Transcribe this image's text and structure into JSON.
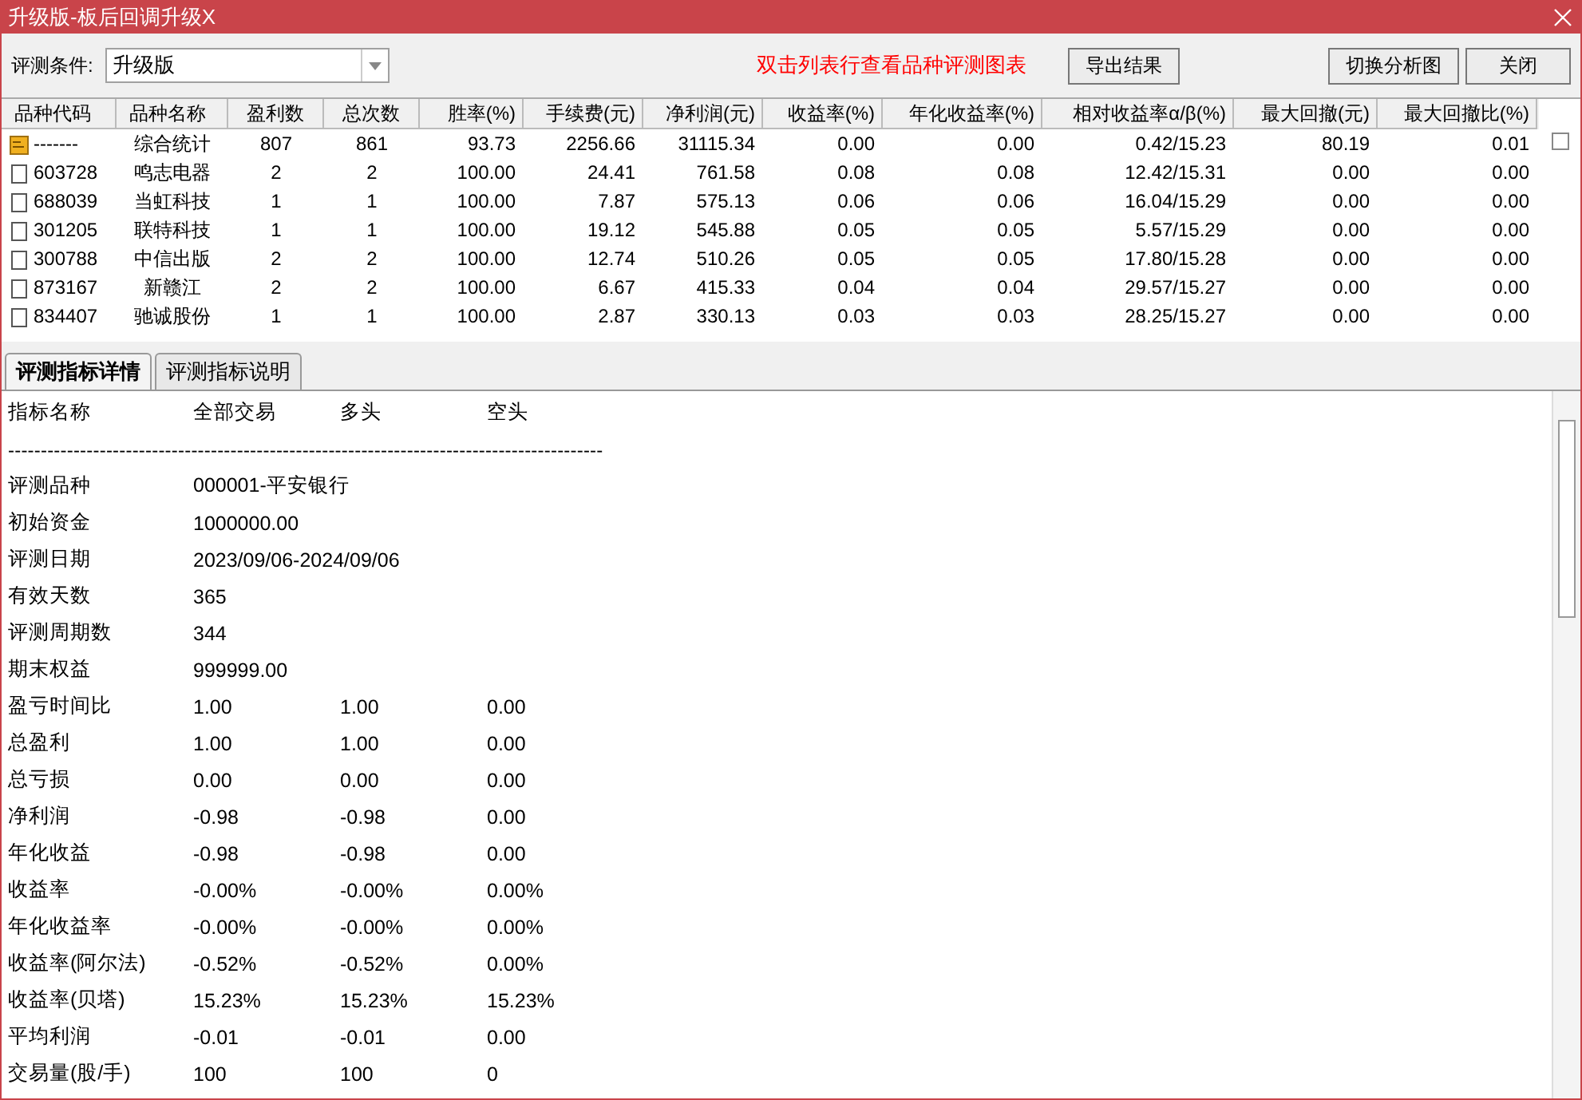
{
  "window": {
    "title": "升级版-板后回调升级X"
  },
  "toolbar": {
    "condition_label": "评测条件:",
    "condition_value": "升级版",
    "hint": "双击列表行查看品种评测图表",
    "buttons": [
      {
        "label": "导出结果",
        "kind": "left"
      },
      {
        "label": "切换分析图",
        "kind": "right"
      },
      {
        "label": "关闭",
        "kind": "right"
      }
    ]
  },
  "table": {
    "columns": [
      "品种代码",
      "品种名称",
      "盈利数",
      "总次数",
      "胜率(%)",
      "手续费(元)",
      "净利润(元)",
      "收益率(%)",
      "年化收益率(%)",
      "相对收益率α/β(%)",
      "最大回撤(元)",
      "最大回撤比(%)"
    ],
    "rows": [
      {
        "kind": "summary",
        "cells": [
          "-------",
          "综合统计",
          "807",
          "861",
          "93.73",
          "2256.66",
          "31115.34",
          "0.00",
          "0.00",
          "0.42/15.23",
          "80.19",
          "0.01"
        ]
      },
      {
        "kind": "item",
        "cells": [
          "603728",
          "鸣志电器",
          "2",
          "2",
          "100.00",
          "24.41",
          "761.58",
          "0.08",
          "0.08",
          "12.42/15.31",
          "0.00",
          "0.00"
        ]
      },
      {
        "kind": "item",
        "cells": [
          "688039",
          "当虹科技",
          "1",
          "1",
          "100.00",
          "7.87",
          "575.13",
          "0.06",
          "0.06",
          "16.04/15.29",
          "0.00",
          "0.00"
        ]
      },
      {
        "kind": "item",
        "cells": [
          "301205",
          "联特科技",
          "1",
          "1",
          "100.00",
          "19.12",
          "545.88",
          "0.05",
          "0.05",
          "5.57/15.29",
          "0.00",
          "0.00"
        ]
      },
      {
        "kind": "item",
        "cells": [
          "300788",
          "中信出版",
          "2",
          "2",
          "100.00",
          "12.74",
          "510.26",
          "0.05",
          "0.05",
          "17.80/15.28",
          "0.00",
          "0.00"
        ]
      },
      {
        "kind": "item",
        "cells": [
          "873167",
          "新赣江",
          "2",
          "2",
          "100.00",
          "6.67",
          "415.33",
          "0.04",
          "0.04",
          "29.57/15.27",
          "0.00",
          "0.00"
        ]
      },
      {
        "kind": "item",
        "cells": [
          "834407",
          "驰诚股份",
          "1",
          "1",
          "100.00",
          "2.87",
          "330.13",
          "0.03",
          "0.03",
          "28.25/15.27",
          "0.00",
          "0.00"
        ]
      }
    ]
  },
  "tabs": [
    {
      "label": "评测指标详情",
      "selected": true
    },
    {
      "label": "评测指标说明",
      "selected": false
    }
  ],
  "details": {
    "header": [
      "指标名称",
      "全部交易",
      "多头",
      "空头"
    ],
    "separator": "-------------------------------------------------------------------------------------------",
    "rows": [
      {
        "label": "评测品种",
        "values": [
          "000001-平安银行"
        ]
      },
      {
        "label": "初始资金",
        "values": [
          "1000000.00"
        ]
      },
      {
        "label": "评测日期",
        "values": [
          "2023/09/06-2024/09/06"
        ]
      },
      {
        "label": "有效天数",
        "values": [
          "365"
        ]
      },
      {
        "label": "评测周期数",
        "values": [
          "344"
        ]
      },
      {
        "label": "期末权益",
        "values": [
          "999999.00"
        ]
      },
      {
        "label": "盈亏时间比",
        "values": [
          "1.00",
          "1.00",
          "0.00"
        ]
      },
      {
        "label": "总盈利",
        "values": [
          "1.00",
          "1.00",
          "0.00"
        ]
      },
      {
        "label": "总亏损",
        "values": [
          "0.00",
          "0.00",
          "0.00"
        ]
      },
      {
        "label": "净利润",
        "values": [
          "-0.98",
          "-0.98",
          "0.00"
        ]
      },
      {
        "label": "年化收益",
        "values": [
          "-0.98",
          "-0.98",
          "0.00"
        ]
      },
      {
        "label": "收益率",
        "values": [
          "-0.00%",
          "-0.00%",
          "0.00%"
        ]
      },
      {
        "label": "年化收益率",
        "values": [
          "-0.00%",
          "-0.00%",
          "0.00%"
        ]
      },
      {
        "label": "收益率(阿尔法)",
        "values": [
          "-0.52%",
          "-0.52%",
          "0.00%"
        ]
      },
      {
        "label": "收益率(贝塔)",
        "values": [
          "15.23%",
          "15.23%",
          "15.23%"
        ]
      },
      {
        "label": "平均利润",
        "values": [
          "-0.01",
          "-0.01",
          "0.00"
        ]
      },
      {
        "label": "交易量(股/手)",
        "values": [
          "100",
          "100",
          "0"
        ]
      }
    ]
  }
}
